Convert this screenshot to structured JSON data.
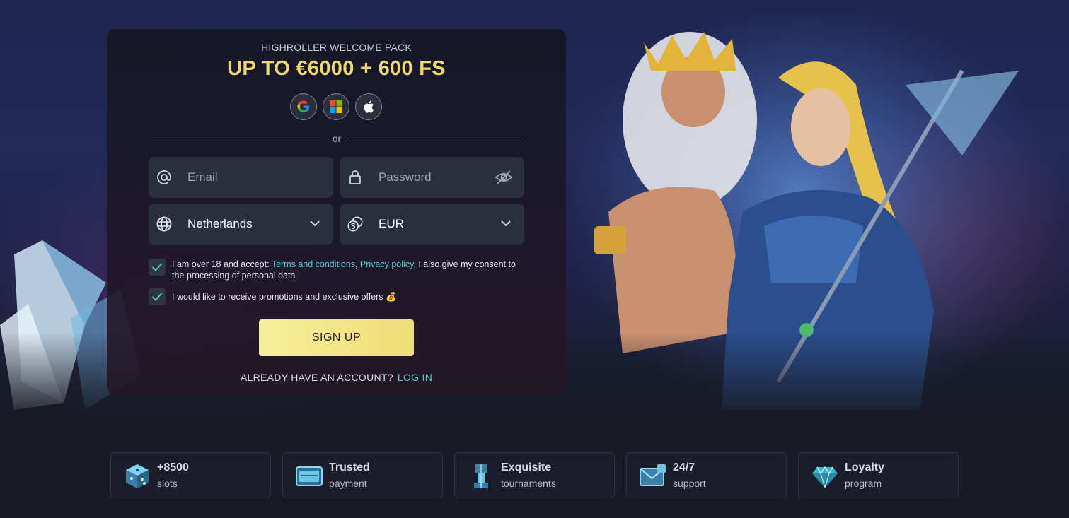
{
  "promo": {
    "subtitle": "HIGHROLLER WELCOME PACK",
    "title": "UP TO €6000 + 600 FS"
  },
  "social": [
    {
      "icon": "google-icon"
    },
    {
      "icon": "microsoft-icon"
    },
    {
      "icon": "apple-icon"
    }
  ],
  "divider_text": "or",
  "form": {
    "email_placeholder": "Email",
    "password_placeholder": "Password",
    "country_value": "Netherlands",
    "currency_value": "EUR"
  },
  "consent": {
    "prefix": "I am over 18 and accept: ",
    "terms_link": "Terms and conditions",
    "comma": ", ",
    "privacy_link": "Privacy policy",
    "suffix": ", I also give my consent to the processing of personal data",
    "checked": true
  },
  "promotions": {
    "text": "I would like to receive promotions and exclusive offers 💰",
    "checked": true
  },
  "signup_label": "SIGN UP",
  "login": {
    "question": "ALREADY HAVE AN ACCOUNT?",
    "link": "LOG IN"
  },
  "features": [
    {
      "icon": "dice-icon",
      "title": "+8500",
      "subtitle": "slots"
    },
    {
      "icon": "card-icon",
      "title": "Trusted",
      "subtitle": "payment"
    },
    {
      "icon": "tower-icon",
      "title": "Exquisite",
      "subtitle": "tournaments"
    },
    {
      "icon": "envelope-icon",
      "title": "24/7",
      "subtitle": "support"
    },
    {
      "icon": "diamond-icon",
      "title": "Loyalty",
      "subtitle": "program"
    }
  ],
  "colors": {
    "accent_gold": "#f0d86a",
    "accent_teal": "#4fd1cf",
    "button_bg": "#f3e584",
    "page_bg": "#181b26"
  }
}
